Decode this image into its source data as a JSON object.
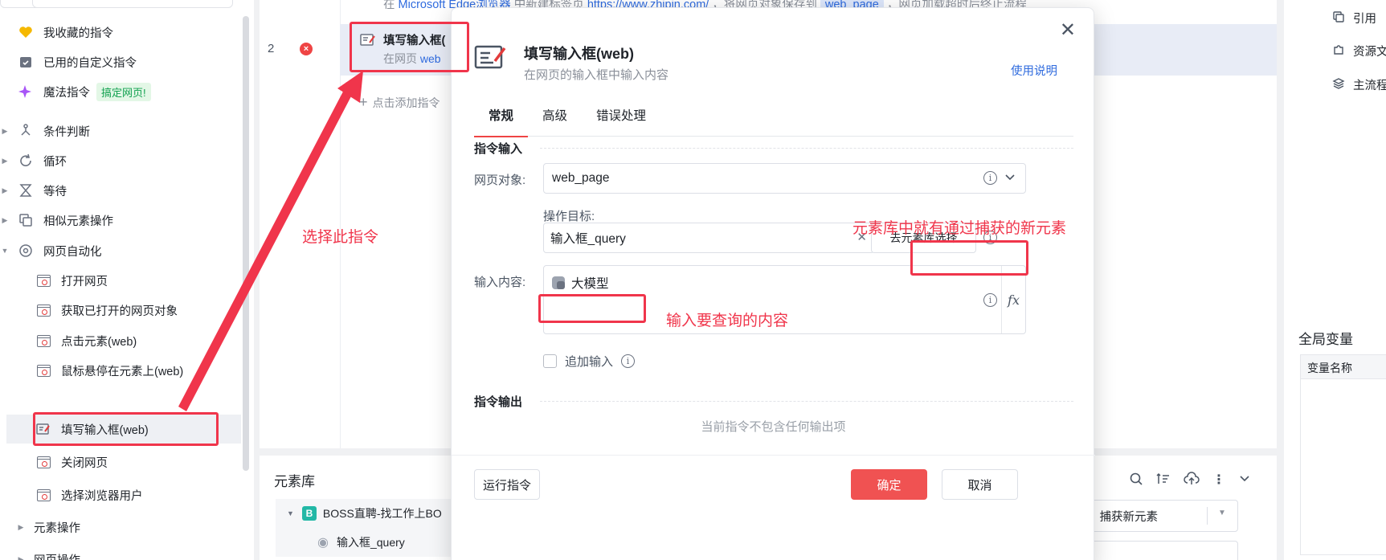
{
  "sidebar": {
    "items": [
      {
        "label": "我收藏的指令"
      },
      {
        "label": "已用的自定义指令"
      },
      {
        "label": "魔法指令",
        "tag": "搞定网页!"
      },
      {
        "label": "条件判断"
      },
      {
        "label": "循环"
      },
      {
        "label": "等待"
      },
      {
        "label": "相似元素操作"
      },
      {
        "label": "网页自动化"
      },
      {
        "label": "打开网页"
      },
      {
        "label": "获取已打开的网页对象"
      },
      {
        "label": "点击元素(web)"
      },
      {
        "label": "鼠标悬停在元素上(web)"
      },
      {
        "label": "填写输入框(web)"
      },
      {
        "label": "关闭网页"
      },
      {
        "label": "选择浏览器用户"
      },
      {
        "label": "元素操作"
      },
      {
        "label": "网页操作"
      }
    ]
  },
  "flow": {
    "top_prefix": "在",
    "top_browser": "Microsoft Edge浏览器",
    "top_mid": "中新建标签页",
    "top_url": "https://www.zhipin.com/",
    "top_save": "，将网页对象保存到",
    "top_var": "web_page",
    "top_tail": "，网页加载超时后终止流程",
    "step_number": "2",
    "step_title": "填写输入框(",
    "step_sub_prefix": "在网页",
    "step_sub_var": "web",
    "add_step": "点击添加指令"
  },
  "right_panel": {
    "items": [
      "引用",
      "资源文",
      "主流程"
    ],
    "global_vars_title": "全局变量",
    "var_name_header": "变量名称"
  },
  "element_library": {
    "title": "元素库",
    "group": "BOSS直聘-找工作上BO",
    "element": "输入框_query",
    "capture_button": "捕获新元素"
  },
  "dialog": {
    "title": "填写输入框(web)",
    "subtitle": "在网页的输入框中输入内容",
    "help_link": "使用说明",
    "tabs": [
      "常规",
      "高级",
      "错误处理"
    ],
    "section_input": "指令输入",
    "web_object_label": "网页对象:",
    "web_object_value": "web_page",
    "op_target_label": "操作目标:",
    "op_target_value": "输入框_query",
    "lib_select_button": "去元素库选择",
    "input_content_label": "输入内容:",
    "input_content_value": "大模型",
    "fx_label": "fx",
    "append_input_label": "追加输入",
    "section_output": "指令输出",
    "no_output_text": "当前指令不包含任何输出项",
    "run_button": "运行指令",
    "ok_button": "确定",
    "cancel_button": "取消"
  },
  "annotations": {
    "select_this": "选择此指令",
    "lib_note": "元素库中就有通过捕获的新元素",
    "input_note": "输入要查询的内容"
  },
  "colors": {
    "accent_red": "#f05252",
    "annotation_red": "#f0354b",
    "link_blue": "#2f6bde"
  }
}
